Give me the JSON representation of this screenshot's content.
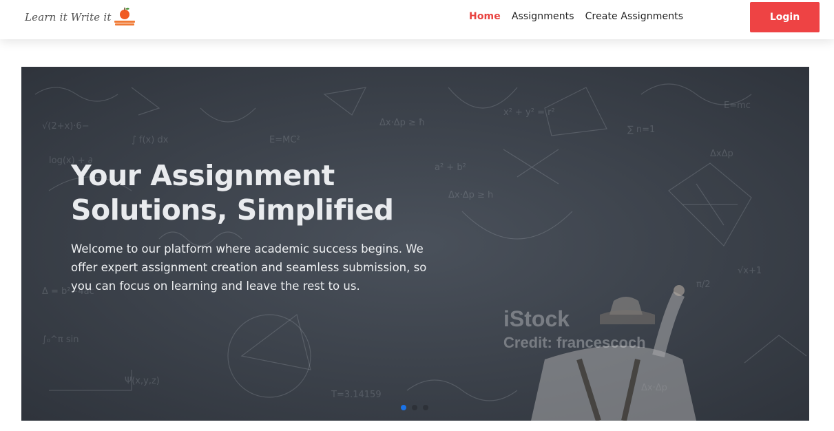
{
  "navbar": {
    "brand": {
      "text": "Learn it Write it",
      "icon": "apple-on-books-icon"
    },
    "links": [
      {
        "label": "Home",
        "active": true
      },
      {
        "label": "Assignments",
        "active": false
      },
      {
        "label": "Create Assignments",
        "active": false
      }
    ],
    "login_label": "Login"
  },
  "hero": {
    "title": "Your Assignment Solutions, Simplified",
    "description": "Welcome to our platform where academic success begins. We offer expert assignment creation and seamless submission, so you can focus on learning and leave the rest to us.",
    "background": "chalkboard-math-photo",
    "watermark": {
      "line1": "iStock",
      "line2": "Credit: francescoch"
    },
    "carousel": {
      "slides": 3,
      "active_index": 0
    }
  },
  "colors": {
    "accent": "#ee4344",
    "active_link": "#e8423f",
    "indicator_active": "#1a73e8",
    "chalkboard": "#3a4049"
  }
}
